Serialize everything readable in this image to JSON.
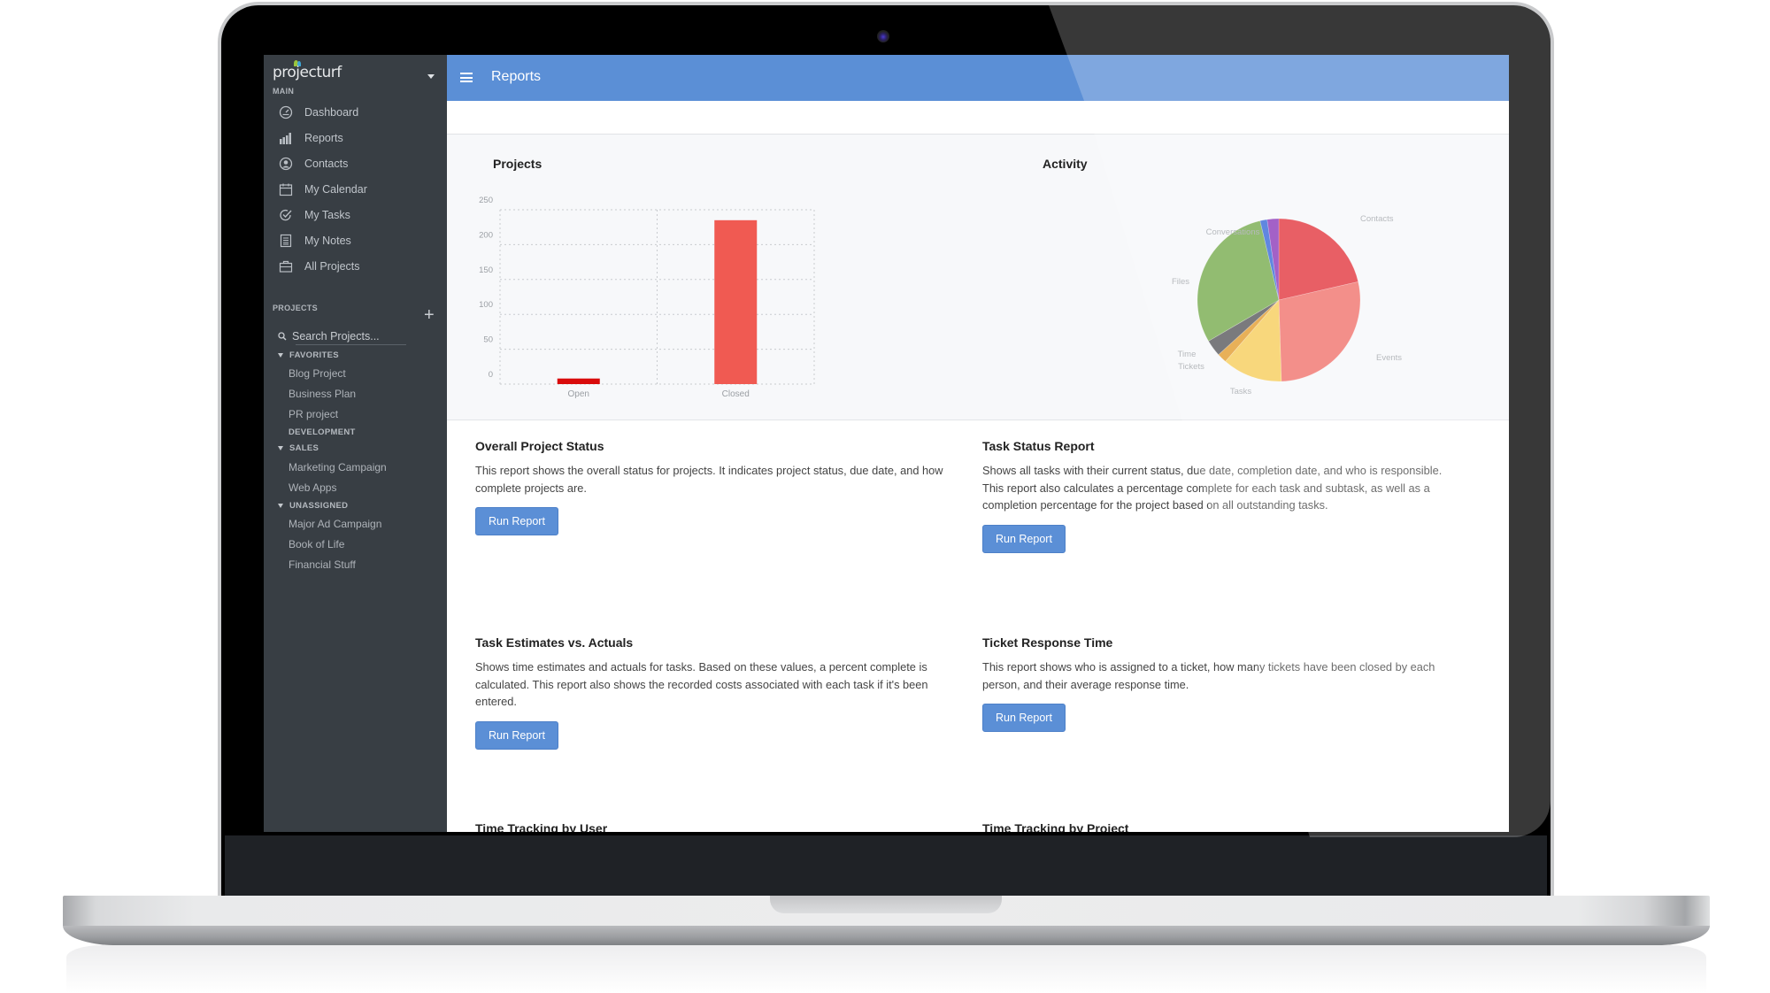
{
  "app": {
    "logo_text": "projecturf"
  },
  "sidebar": {
    "main_label": "MAIN",
    "nav": [
      {
        "label": "Dashboard",
        "icon": "dashboard-icon"
      },
      {
        "label": "Reports",
        "icon": "bar-chart-icon"
      },
      {
        "label": "Contacts",
        "icon": "contact-icon"
      },
      {
        "label": "My Calendar",
        "icon": "calendar-icon"
      },
      {
        "label": "My Tasks",
        "icon": "check-circle-icon"
      },
      {
        "label": "My Notes",
        "icon": "notes-icon"
      },
      {
        "label": "All Projects",
        "icon": "briefcase-icon"
      }
    ],
    "projects_label": "PROJECTS",
    "search_placeholder": "Search Projects...",
    "groups": {
      "favorites": {
        "label": "FAVORITES",
        "items": [
          "Blog Project",
          "Business Plan",
          "PR project"
        ]
      },
      "development": {
        "label": "DEVELOPMENT"
      },
      "sales": {
        "label": "SALES",
        "items": [
          "Marketing Campaign",
          "Web Apps"
        ]
      },
      "unassigned": {
        "label": "UNASSIGNED",
        "items": [
          "Major Ad Campaign",
          "Book of Life",
          "Financial Stuff"
        ]
      }
    }
  },
  "header": {
    "title": "Reports"
  },
  "colors": {
    "accent": "#5b8fd6",
    "sidebar_bg": "#383e44"
  },
  "chart_data": [
    {
      "type": "bar",
      "title": "Projects",
      "categories": [
        "Open",
        "Closed"
      ],
      "values": [
        8,
        235
      ],
      "colors": [
        "#d90b0b",
        "#f05a52"
      ],
      "ylim": [
        0,
        250
      ],
      "yticks": [
        0,
        50,
        100,
        150,
        200,
        250
      ],
      "xlabel": "",
      "ylabel": "",
      "grid": true
    },
    {
      "type": "pie",
      "title": "Activity",
      "slices": [
        {
          "label": "Contacts",
          "value": 21.4,
          "color": "#e2323a"
        },
        {
          "label": "Events",
          "value": 28.1,
          "color": "#f0706a"
        },
        {
          "label": "Tasks",
          "value": 11.9,
          "color": "#f6cc58"
        },
        {
          "label": "Tickets",
          "value": 1.9,
          "color": "#e29a2a"
        },
        {
          "label": "Time",
          "value": 3.3,
          "color": "#555559"
        },
        {
          "label": "Files",
          "value": 29.7,
          "color": "#74a94a"
        },
        {
          "label": "",
          "value": 1.4,
          "color": "#3466d8"
        },
        {
          "label": "Conversations",
          "value": 2.3,
          "color": "#8a35b8"
        }
      ]
    }
  ],
  "reports": [
    {
      "title": "Overall Project Status",
      "description": "This report shows the overall status for projects. It indicates project status, due date, and how complete projects are.",
      "button": "Run Report"
    },
    {
      "title": "Task Status Report",
      "description": "Shows all tasks with their current status, due date, completion date, and who is responsible. This report also calculates a percentage complete for each task and subtask, as well as a completion percentage for the project based on all outstanding tasks.",
      "button": "Run Report"
    },
    {
      "title": "Task Estimates vs. Actuals",
      "description": "Shows time estimates and actuals for tasks. Based on these values, a percent complete is calculated. This report also shows the recorded costs associated with each task if it's been entered.",
      "button": "Run Report"
    },
    {
      "title": "Ticket Response Time",
      "description": "This report shows who is assigned to a ticket, how many tickets have been closed by each person, and their average response time.",
      "button": "Run Report"
    },
    {
      "title": "Time Tracking by User"
    },
    {
      "title": "Time Tracking by Project"
    }
  ]
}
